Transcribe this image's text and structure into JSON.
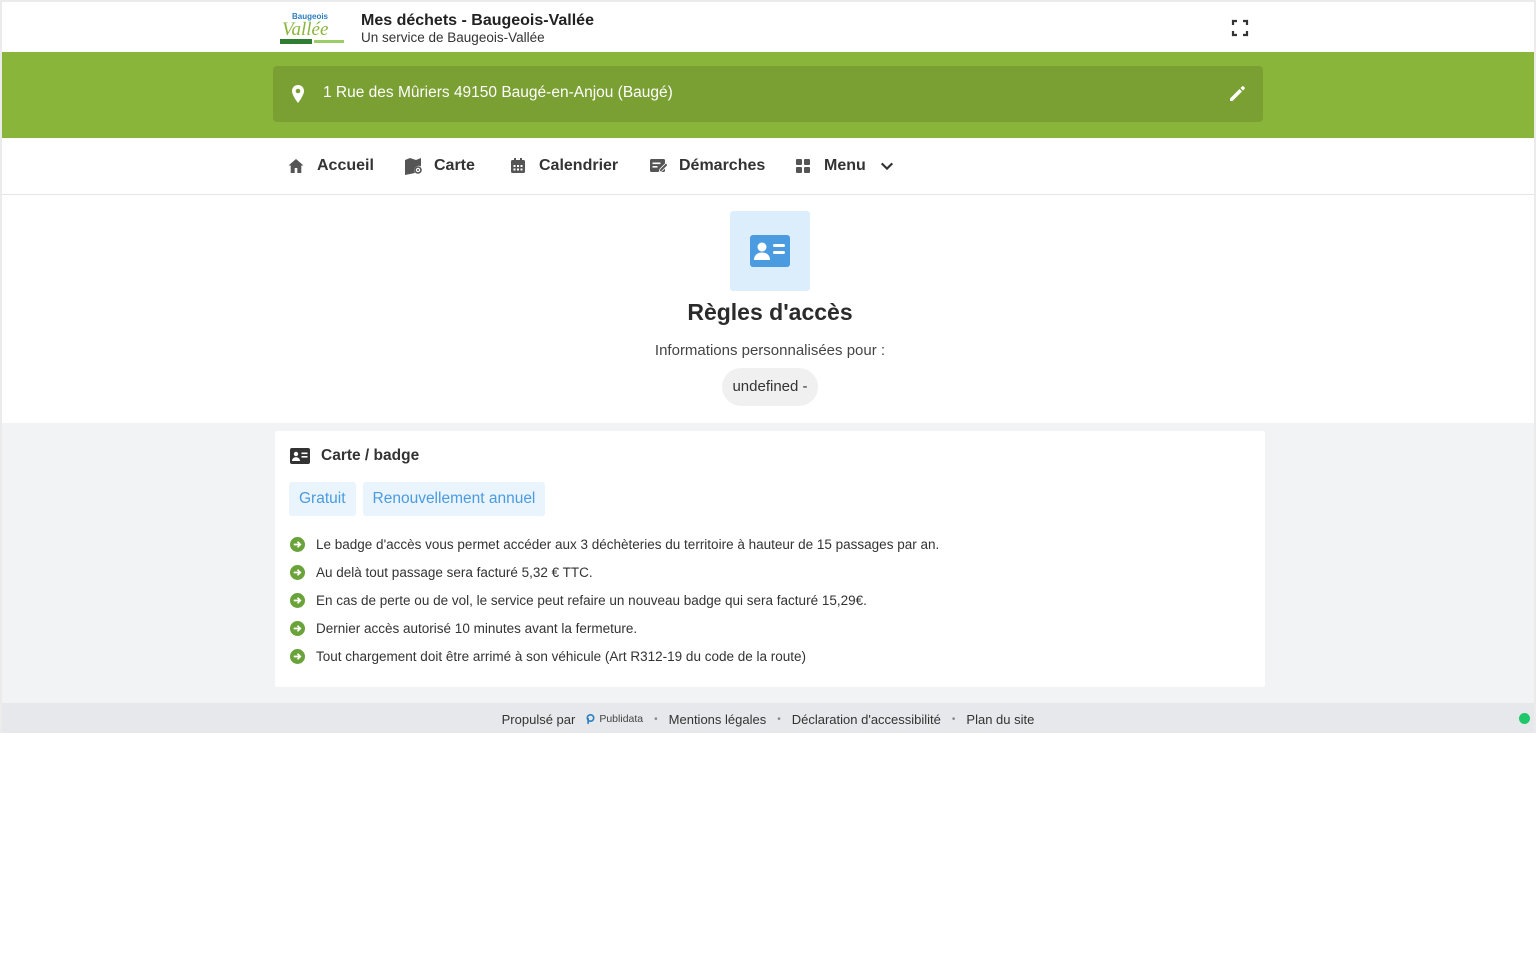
{
  "header": {
    "title": "Mes déchets - Baugeois-Vallée",
    "subtitle": "Un service de Baugeois-Vallée",
    "logo_text_top": "Baugeois",
    "logo_text_main": "Vallée"
  },
  "address": {
    "text": "1 Rue des Mûriers 49150 Baugé-en-Anjou (Baugé)"
  },
  "nav": {
    "items": [
      {
        "label": "Accueil",
        "icon": "home-icon"
      },
      {
        "label": "Carte",
        "icon": "map-icon"
      },
      {
        "label": "Calendrier",
        "icon": "calendar-icon"
      },
      {
        "label": "Démarches",
        "icon": "form-icon"
      },
      {
        "label": "Menu",
        "icon": "grid-icon"
      }
    ]
  },
  "hero": {
    "icon": "id-card-icon",
    "title": "Règles d'accès",
    "subtitle": "Informations personnalisées pour :",
    "chip": "undefined -"
  },
  "card": {
    "title": "Carte / badge",
    "tags": [
      "Gratuit",
      "Renouvellement annuel"
    ],
    "rules": [
      "Le badge d'accès vous permet accéder aux 3 déchèteries du territoire à hauteur de 15 passages par an.",
      "Au delà tout passage sera facturé 5,32 € TTC.",
      "En cas de perte ou de vol, le service peut refaire un nouveau badge qui sera facturé 15,29€.",
      "Dernier accès autorisé 10 minutes avant la fermeture.",
      "Tout chargement doit être arrimé à son véhicule (Art R312-19 du code de la route)"
    ]
  },
  "footer": {
    "powered_by": "Propulsé par",
    "brand": "Publidata",
    "links": [
      "Mentions légales",
      "Déclaration d'accessibilité",
      "Plan du site"
    ]
  },
  "colors": {
    "brand_green": "#8ab53b",
    "accent_blue": "#4a9be0",
    "status_green": "#1ec76a"
  }
}
